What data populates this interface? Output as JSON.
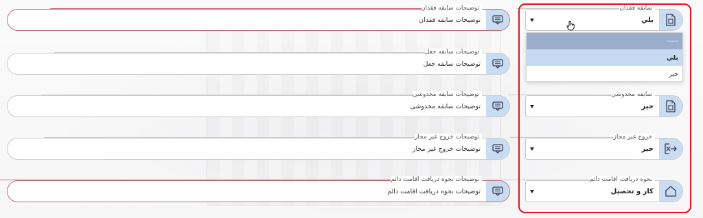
{
  "rows": [
    {
      "select": {
        "label": "سابقه فقدان",
        "value": "بلي",
        "icon": "document-icon"
      },
      "description": {
        "label": "توضیحات سابقه فقدان",
        "value": "توضیحات سابقه فقدان",
        "icon": "message-icon",
        "alert": true
      }
    },
    {
      "description": {
        "label": "توضیحات سابقه جعل",
        "value": "توضیحات سابقه جعل",
        "icon": "message-icon",
        "alert": false
      }
    },
    {
      "select": {
        "label": "سابقه مخدوشی",
        "value": "خیر",
        "icon": "document-icon"
      },
      "description": {
        "label": "توضیحات سابقه مخدوشی",
        "value": "توضیحات سابقه مخدوشی",
        "icon": "message-icon",
        "alert": false
      }
    },
    {
      "select": {
        "label": "خروج غیر مجاز",
        "value": "خیر",
        "icon": "exit-icon"
      },
      "description": {
        "label": "توضیحات خروج غیر مجاز",
        "value": "توضیحات خروج غیر مجاز",
        "icon": "message-icon",
        "alert": false
      }
    },
    {
      "select": {
        "label": "نحوه دریافت اقامت دائم",
        "value": "کار و تحصیل",
        "icon": "home-icon"
      },
      "description": {
        "label": "توضیحات نحوه دریافت اقامت دائم",
        "value": "توضیحات نحوه دریافت اقامت دائم",
        "icon": "message-icon",
        "alert": true
      }
    }
  ],
  "dropdown": {
    "options": [
      "-----",
      "بلي",
      "خیر"
    ],
    "selected_index": 1
  },
  "colors": {
    "icon_bg": "#c8ddf1",
    "highlight_border": "#e3121b",
    "alert_border": "#c66a7a",
    "selected_option": "#c6daf2",
    "placeholder_option": "#9aaecb"
  }
}
